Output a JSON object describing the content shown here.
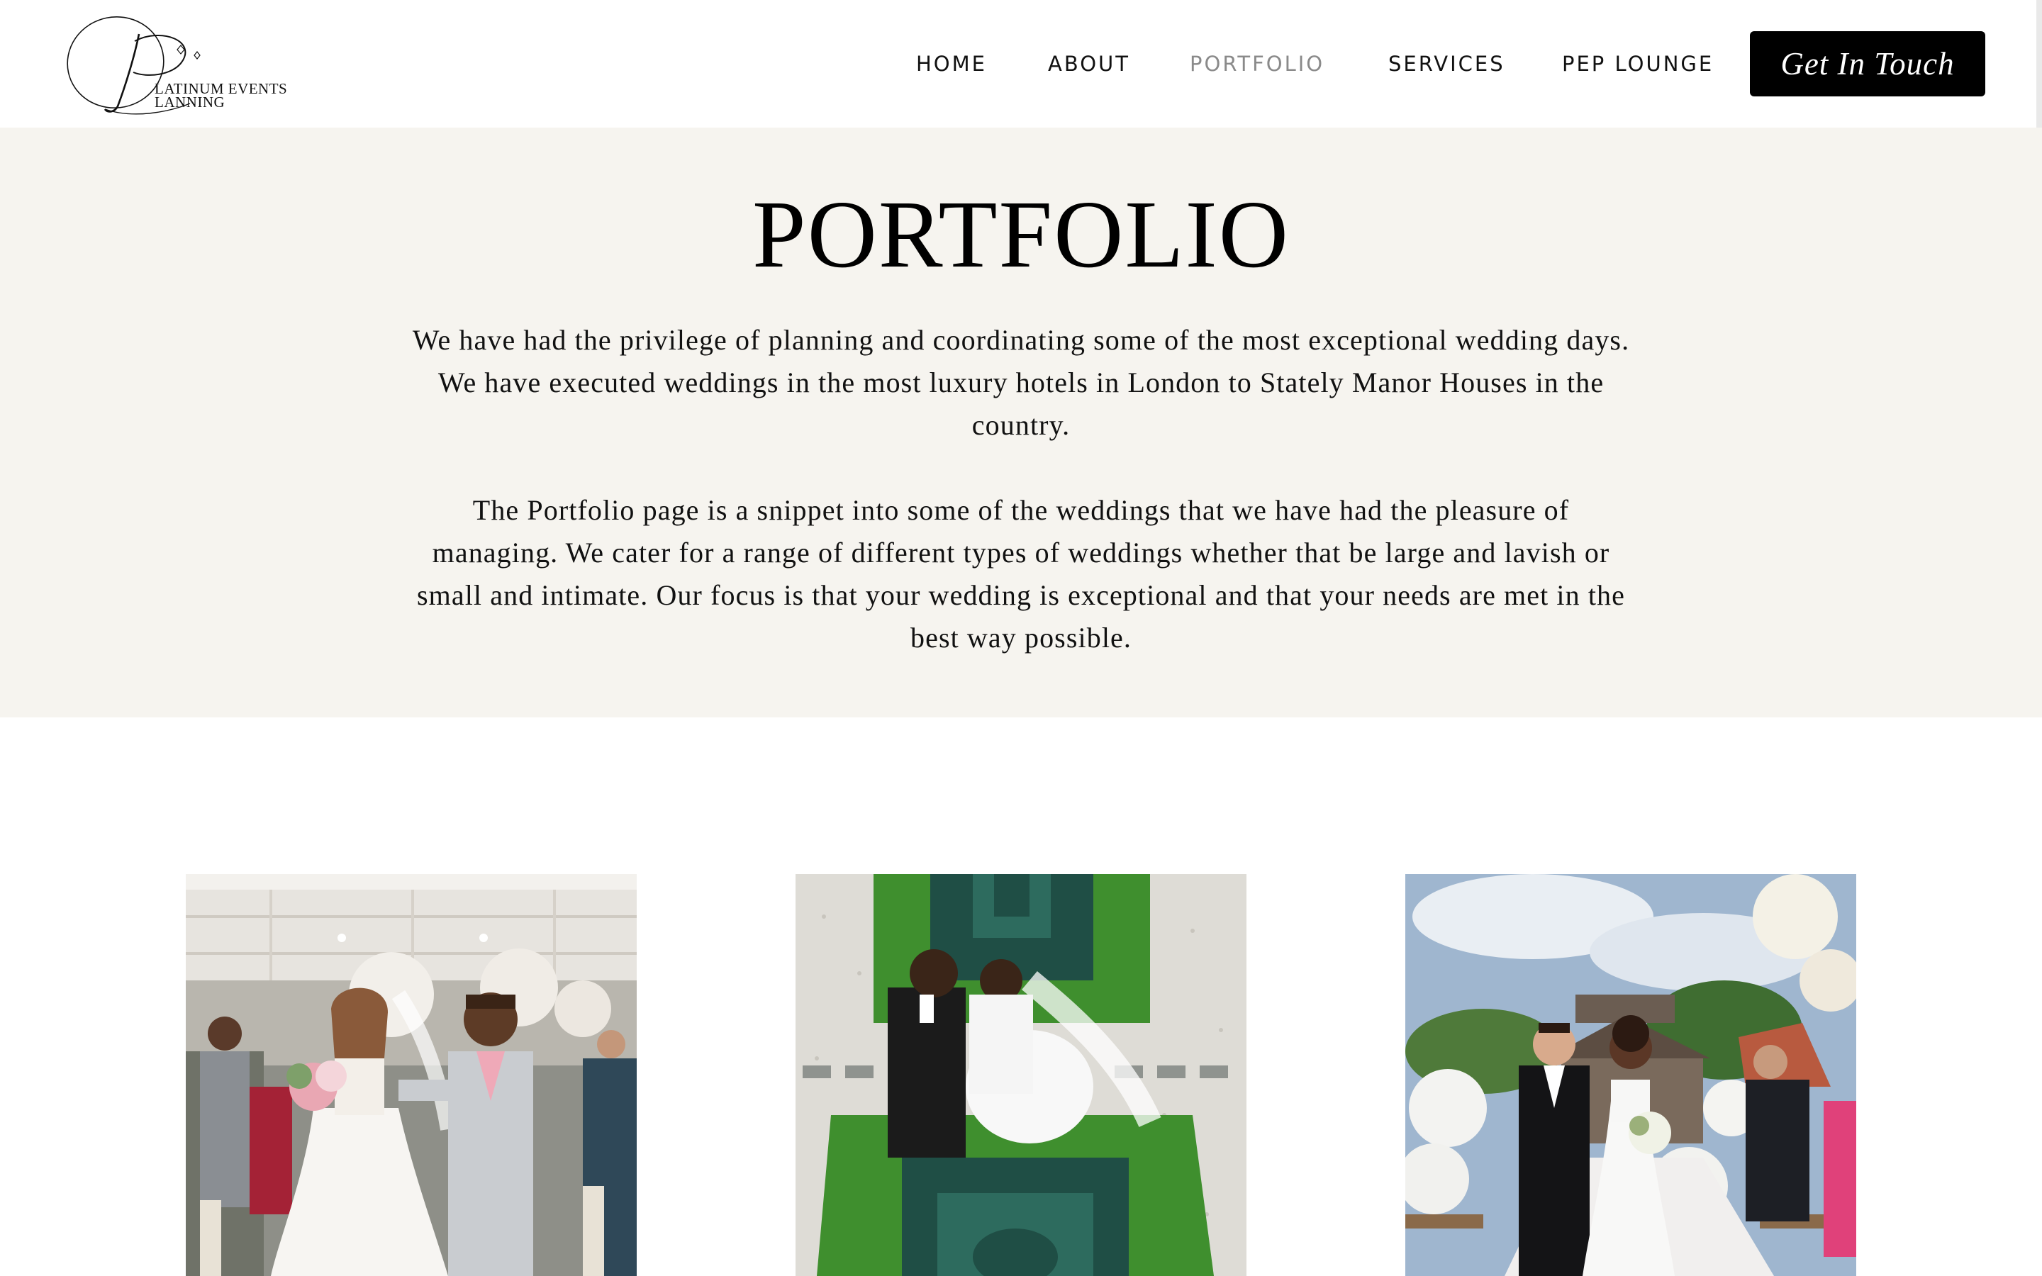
{
  "brand": {
    "logo_line1": "LATINUM EVENTS",
    "logo_line2": "LANNING"
  },
  "nav": {
    "items": [
      {
        "label": "HOME"
      },
      {
        "label": "ABOUT"
      },
      {
        "label": "PORTFOLIO",
        "active": true
      },
      {
        "label": "SERVICES"
      },
      {
        "label": "PEP LOUNGE"
      }
    ],
    "cta_label": "Get In Touch"
  },
  "intro": {
    "title": "PORTFOLIO",
    "paragraph1": "We have had the privilege of planning and coordinating some of the most exceptional wedding days. We have executed weddings in the most luxury hotels in London to Stately Manor Houses in the country.",
    "paragraph2": "The Portfolio page is a snippet into some of the weddings that we have had the pleasure of managing. We cater for a range of different types of weddings whether that be large and lavish or small and intimate. Our focus is that your wedding is exceptional and that your needs are met in the best way possible."
  },
  "colors": {
    "intro_background": "#f6f4ef",
    "cta_background": "#000000",
    "nav_active": "#8a8a8a"
  },
  "gallery": [
    {
      "icon": "wedding-photo-ceremony-exit"
    },
    {
      "icon": "wedding-photo-garden-aerial"
    },
    {
      "icon": "wedding-photo-outdoor-aisle"
    }
  ]
}
